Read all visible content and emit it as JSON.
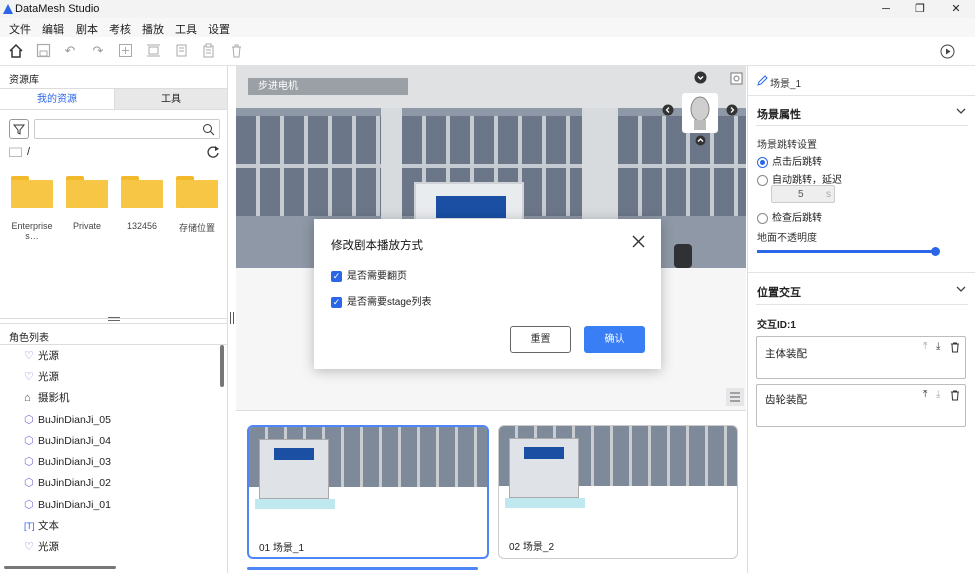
{
  "app": {
    "title": "DataMesh Studio"
  },
  "window": {
    "minimize": "─",
    "restore": "❐",
    "close": "✕"
  },
  "menu": [
    "文件",
    "编辑",
    "剧本",
    "考核",
    "播放",
    "工具",
    "设置"
  ],
  "left": {
    "library_title": "资源库",
    "tabs": [
      {
        "label": "我的资源",
        "active": true
      },
      {
        "label": "工具",
        "active": false
      }
    ],
    "path": "/",
    "folders": [
      "Enterprise s…",
      "Private",
      "132456",
      "存储位置"
    ],
    "roles_title": "角色列表",
    "roles": [
      {
        "icon": "lightbulb-icon",
        "label": "光源"
      },
      {
        "icon": "lightbulb-icon",
        "label": "光源"
      },
      {
        "icon": "camera-icon",
        "label": "摄影机"
      },
      {
        "icon": "cube-icon",
        "label": "BuJinDianJi_05"
      },
      {
        "icon": "cube-icon",
        "label": "BuJinDianJi_04"
      },
      {
        "icon": "cube-icon",
        "label": "BuJinDianJi_03"
      },
      {
        "icon": "cube-icon",
        "label": "BuJinDianJi_02"
      },
      {
        "icon": "cube-icon",
        "label": "BuJinDianJi_01"
      },
      {
        "icon": "text-icon",
        "label": "文本"
      },
      {
        "icon": "lightbulb-icon",
        "label": "光源"
      }
    ]
  },
  "viewport": {
    "scene_name": "步进电机"
  },
  "modal": {
    "title": "修改剧本播放方式",
    "options": [
      {
        "label": "是否需要翻页",
        "checked": true
      },
      {
        "label": "是否需要stage列表",
        "checked": true
      }
    ],
    "reset": "重置",
    "confirm": "确认"
  },
  "scenes": [
    {
      "label": "01  场景_1",
      "selected": true
    },
    {
      "label": "02  场景_2",
      "selected": false
    }
  ],
  "right": {
    "scene_name": "场景_1",
    "properties_title": "场景属性",
    "jump_title": "场景跳转设置",
    "jump_options": [
      {
        "label": "点击后跳转",
        "selected": true
      },
      {
        "label": "自动跳转，延迟",
        "selected": false
      }
    ],
    "delay_value": "5",
    "delay_unit": "s",
    "check_option": {
      "label": "检查后跳转",
      "selected": false
    },
    "opacity_label": "地面不透明度",
    "opacity_value": 1.0,
    "interaction_title": "位置交互",
    "interaction_id": "交互ID:1",
    "cards": [
      "主体装配",
      "齿轮装配"
    ]
  },
  "colors": {
    "accent": "#2b66e8",
    "folder": "#f7c645"
  }
}
